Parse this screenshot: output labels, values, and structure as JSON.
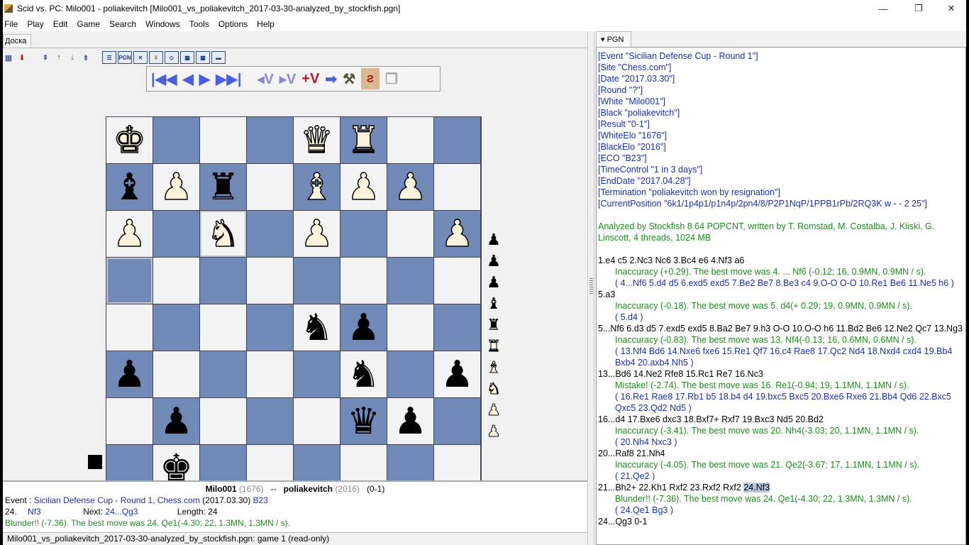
{
  "window": {
    "title": "Scid vs. PC: Milo001 - poliakevitch [Milo001_vs_poliakevitch_2017-03-30-analyzed_by_stockfish.pgn]",
    "controls": {
      "minimize": "—",
      "maximize": "❐",
      "close": "✕"
    }
  },
  "menu": [
    "File",
    "Play",
    "Edit",
    "Game",
    "Search",
    "Windows",
    "Tools",
    "Options",
    "Help"
  ],
  "left_tab": "Доска",
  "toolbar": {
    "icons": [
      "new-game-icon",
      "save-game-icon",
      "first-game-icon",
      "prev-game-icon",
      "next-game-icon",
      "last-game-icon",
      "gamelist-icon",
      "pgn-icon",
      "tools-icon",
      "tree-icon",
      "book-icon",
      "crosstable-icon",
      "search-icon",
      "engine-icon"
    ],
    "pgn_label": "PGN"
  },
  "nav": {
    "start": "|◀◀",
    "back": "◀",
    "forward": "▶",
    "end": "▶▶|",
    "var_back": "◂V",
    "var_fwd": "▸V",
    "add_var": "+V"
  },
  "board": {
    "flipped": true,
    "rows": [
      [
        "wK",
        "",
        "",
        "",
        "wQ",
        "wR",
        "",
        ""
      ],
      [
        "bB",
        "wP",
        "bR",
        "",
        "wB",
        "wP",
        "wP",
        ""
      ],
      [
        "wP",
        "",
        "wN",
        "",
        "wP",
        "",
        "",
        "wP"
      ],
      [
        "",
        "",
        "",
        "",
        "",
        "",
        "",
        ""
      ],
      [
        "",
        "",
        "",
        "",
        "bN",
        "bP",
        "",
        ""
      ],
      [
        "bP",
        "",
        "",
        "",
        "",
        "bN",
        "",
        "bP"
      ],
      [
        "",
        "bP",
        "",
        "",
        "",
        "bQ",
        "bP",
        ""
      ],
      [
        "",
        "bK",
        "",
        "",
        "",
        "",
        "",
        ""
      ]
    ],
    "highlighted": [
      [
        2,
        2
      ],
      [
        3,
        0
      ]
    ],
    "side_to_move": "black"
  },
  "captured": [
    "bP",
    "bP",
    "bP",
    "bB",
    "bR",
    "wR",
    "wB",
    "wN",
    "wP",
    "wP"
  ],
  "info": {
    "white": "Milo001",
    "white_elo": "(1676)",
    "sep": "--",
    "black": "poliakevitch",
    "black_elo": "(2016)",
    "result": "(0-1)",
    "event_label": "Event :",
    "event": "Sicilian Defense Cup - Round 1, Chess.com",
    "date": "(2017.03.30)",
    "eco": "B23",
    "move_no": "24.",
    "move": "Nf3",
    "next_label": "Next:",
    "next_move": "24...Qg3",
    "length_label": "Length: 24",
    "comment": "Blunder!! (-7.36). The best move was 24. Qe1(-4.30; 22, 1.3MN, 1.3MN / s)."
  },
  "status": "Milo001_vs_poliakevitch_2017-03-30-analyzed_by_stockfish.pgn: game  1   (read-only)",
  "pgn": {
    "tab_label": "▾ PGN",
    "headers": [
      "[Event \"Sicilian Defense Cup - Round 1\"]",
      "[Site \"Chess.com\"]",
      "[Date \"2017.03.30\"]",
      "[Round \"?\"]",
      "[White \"Milo001\"]",
      "[Black \"poliakevitch\"]",
      "[Result \"0-1\"]",
      "[WhiteElo \"1676\"]",
      "[BlackElo \"2016\"]",
      "[ECO \"B23\"]",
      "[TimeControl \"1 in 3 days\"]",
      "[EndDate \"2017.04.28\"]",
      "[Termination \"poliakevitch won by resignation\"]",
      "[CurrentPosition \"6k1/1p4p1/p1n4p/2pn4/8/P2P1NqP/1PPB1rPb/2RQ3K w - - 2 25\"]"
    ],
    "analyzed_by": "Analyzed by Stockfish 8 64 POPCNT, written by T. Romstad, M. Costalba, J. Kiiski, G. Linscott, 4 threads, 1024 MB",
    "body": [
      {
        "type": "mv",
        "text": "1.e4 c5 2.Nc3 Nc6 3.Bc4 e6 4.Nf3 a6"
      },
      {
        "type": "cmt",
        "text": "Inaccuracy (+0.29). The best move was 4. ... Nf6 (-0.12; 16, 0.9MN, 0.9MN / s)."
      },
      {
        "type": "var",
        "text": "( 4...Nf6 5.d4 d5 6.exd5 exd5 7.Be2 Be7 8.Be3 c4 9.O-O O-O 10.Re1 Be6 11.Ne5 h6 )"
      },
      {
        "type": "mv",
        "text": "5.a3"
      },
      {
        "type": "cmt",
        "text": "Inaccuracy (-0.18). The best move was 5. d4(+ 0.29; 19, 0.9MN, 0.9MN / s)."
      },
      {
        "type": "var",
        "text": "( 5.d4 )"
      },
      {
        "type": "mv",
        "text": "5...Nf6 6.d3 d5 7.exd5 exd5 8.Ba2 Be7 9.h3 O-O 10.O-O h6 11.Bd2 Be6 12.Ne2 Qc7 13.Ng3"
      },
      {
        "type": "cmt",
        "text": "Inaccuracy (-0.83). The best move was 13. Nf4(-0.13; 16, 0.6MN, 0.6MN / s)."
      },
      {
        "type": "var",
        "text": "( 13.Nf4 Bd6 14.Nxe6 fxe6 15.Re1 Qf7 16.c4 Rae8 17.Qc2 Nd4 18.Nxd4 cxd4 19.Bb4 Bxb4 20.axb4 Nh5 )"
      },
      {
        "type": "mv",
        "text": "13...Bd6 14.Ne2 Rfe8 15.Rc1 Re7 16.Nc3"
      },
      {
        "type": "cmt",
        "text": "Mistake! (-2.74). The best move was 16. Re1(-0.94; 19, 1.1MN, 1.1MN / s)."
      },
      {
        "type": "var",
        "text": "( 16.Re1 Rae8 17.Rb1 b5 18.b4 d4 19.bxc5 Bxc5 20.Bxe6 Rxe6 21.Bb4 Qd6 22.Bxc5 Qxc5 23.Qd2 Nd5 )"
      },
      {
        "type": "mv",
        "text": "16...d4 17.Bxe6 dxc3 18.Bxf7+ Rxf7 19.Bxc3 Nd5 20.Bd2"
      },
      {
        "type": "cmt",
        "text": "Inaccuracy (-3.41). The best move was 20. Nh4(-3.03; 20, 1.1MN, 1.1MN / s)."
      },
      {
        "type": "var",
        "text": "( 20.Nh4 Nxc3 )"
      },
      {
        "type": "mv",
        "text": "20...Raf8 21.Nh4"
      },
      {
        "type": "cmt",
        "text": "Inaccuracy (-4.05). The best move was 21. Qe2(-3.67; 17, 1.1MN, 1.1MN / s)."
      },
      {
        "type": "var",
        "text": "( 21.Qe2 )"
      },
      {
        "type": "mv_cur",
        "text": "21...Bh2+ 22.Kh1 Rxf2 23.Rxf2 Rxf2 ",
        "current": "24.Nf3"
      },
      {
        "type": "cmt",
        "text": "Blunder!! (-7.36). The best move was 24. Qe1(-4.30; 22, 1.3MN, 1.3MN / s)."
      },
      {
        "type": "var",
        "text": "( 24.Qe1 Bg3 )"
      },
      {
        "type": "mv",
        "text": "24...Qg3 0-1"
      }
    ]
  }
}
